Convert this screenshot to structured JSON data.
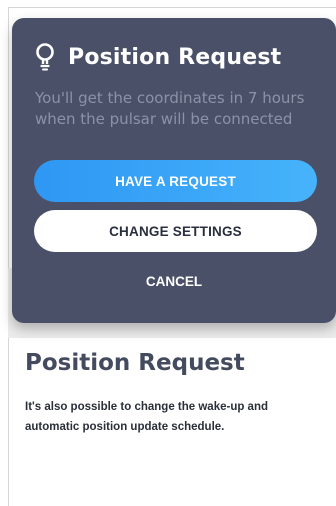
{
  "dialog": {
    "icon": "lightbulb-icon",
    "title": "Position Request",
    "description": "You'll get the coordinates in 7 hours when the pulsar will be connected",
    "primary_button": "HAVE A REQUEST",
    "secondary_button": "CHANGE SETTINGS",
    "cancel_button": "CANCEL"
  },
  "page": {
    "title": "Position Request",
    "body": "It's also possible to change the wake-up and automatic position update schedule."
  },
  "colors": {
    "dialog_background": "#4a5068",
    "primary_accent": "#2e97f4",
    "text_light": "#ffffff",
    "text_muted": "#8c92a6",
    "page_title": "#454b5e"
  }
}
